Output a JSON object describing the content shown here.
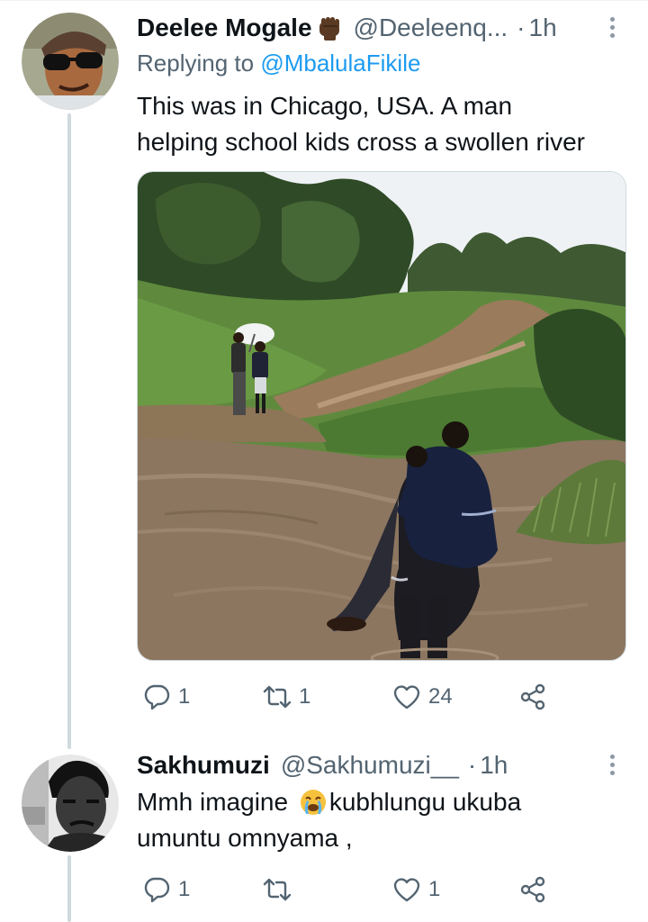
{
  "tweets": [
    {
      "display_name": "Deelee Mogale",
      "badge_emoji": "fist-emoji",
      "handle": "@Deeleenq...",
      "separator": "·",
      "time": "1h",
      "reply_prefix": "Replying to ",
      "reply_to": "@MbalulaFikile",
      "text_lines": [
        "This was in Chicago, USA. A man",
        "helping school kids cross a swollen river"
      ],
      "has_media": true,
      "stats": {
        "replies": "1",
        "retweets": "1",
        "likes": "24"
      }
    },
    {
      "display_name": "Sakhumuzi",
      "handle": "@Sakhumuzi__",
      "separator": "·",
      "time": "1h",
      "text_line1_before": "Mmh imagine ",
      "text_emoji": "crying-face-emoji",
      "text_line1_after": "kubhlungu ukuba",
      "text_line2": "umuntu omnyama ,",
      "stats": {
        "replies": "1",
        "retweets": "",
        "likes": "1"
      }
    }
  ],
  "icons": {
    "reply": "speech-bubble-icon",
    "retweet": "retweet-arrows-icon",
    "like": "heart-icon",
    "share": "share-nodes-icon",
    "more": "vertical-dots-icon"
  },
  "colors": {
    "text": "#0f1419",
    "muted": "#536471",
    "link": "#1d9bf0",
    "thread_line": "#cfd9de"
  }
}
